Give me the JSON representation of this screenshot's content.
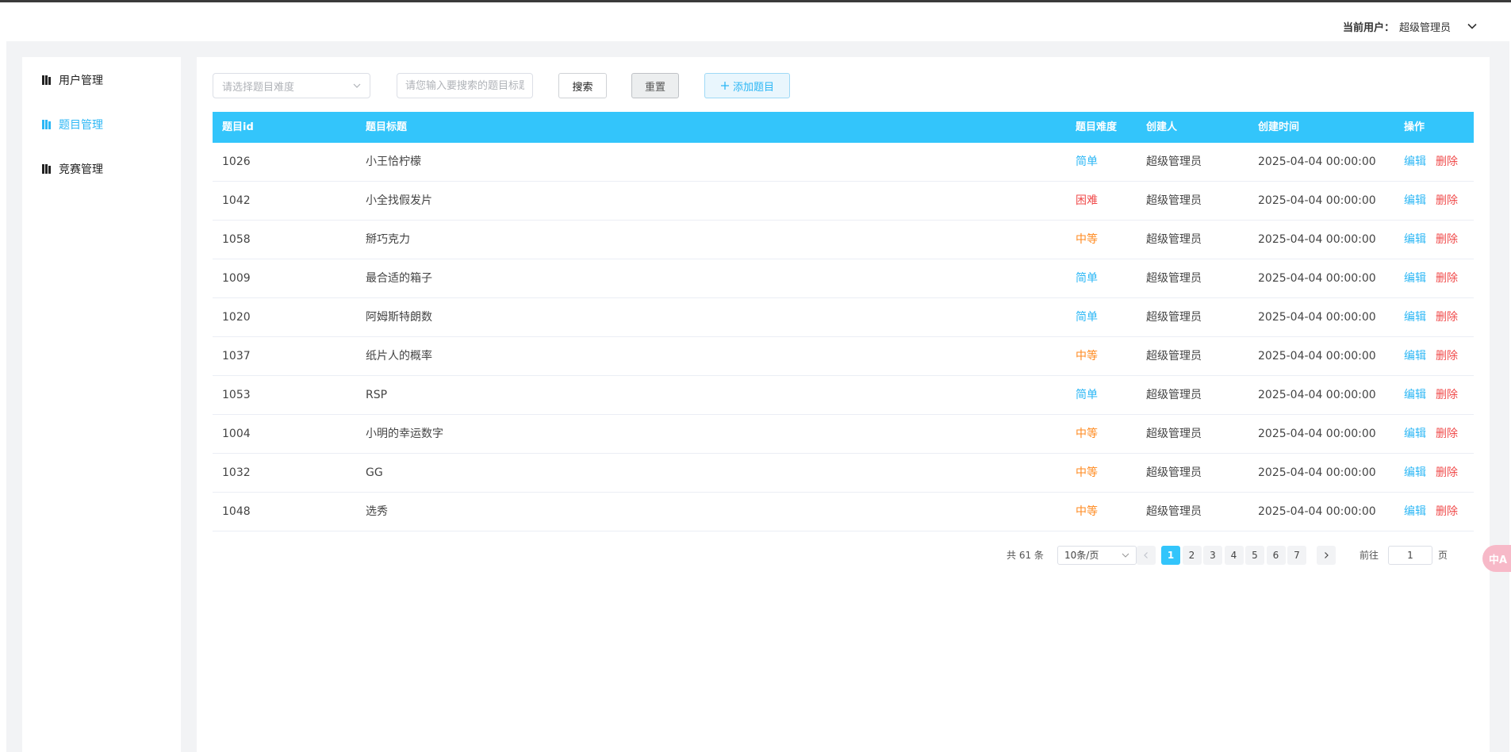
{
  "header": {
    "user_label": "当前用户：",
    "user_name": "超级管理员"
  },
  "sidebar": {
    "items": [
      {
        "label": "用户管理"
      },
      {
        "label": "题目管理"
      },
      {
        "label": "竞赛管理"
      }
    ]
  },
  "toolbar": {
    "difficulty_placeholder": "请选择题目难度",
    "search_placeholder": "请您输入要搜索的题目标题",
    "search_label": "搜索",
    "reset_label": "重置",
    "add_label": "添加题目"
  },
  "table": {
    "headers": {
      "id": "题目id",
      "title": "题目标题",
      "difficulty": "题目难度",
      "creator": "创建人",
      "created_at": "创建时间",
      "actions": "操作"
    },
    "edit_label": "编辑",
    "delete_label": "删除",
    "rows": [
      {
        "id": "1026",
        "title": "小王恰柠檬",
        "difficulty": "简单",
        "creator": "超级管理员",
        "created_at": "2025-04-04 00:00:00"
      },
      {
        "id": "1042",
        "title": "小全找假发片",
        "difficulty": "困难",
        "creator": "超级管理员",
        "created_at": "2025-04-04 00:00:00"
      },
      {
        "id": "1058",
        "title": "掰巧克力",
        "difficulty": "中等",
        "creator": "超级管理员",
        "created_at": "2025-04-04 00:00:00"
      },
      {
        "id": "1009",
        "title": "最合适的箱子",
        "difficulty": "简单",
        "creator": "超级管理员",
        "created_at": "2025-04-04 00:00:00"
      },
      {
        "id": "1020",
        "title": "阿姆斯特朗数",
        "difficulty": "简单",
        "creator": "超级管理员",
        "created_at": "2025-04-04 00:00:00"
      },
      {
        "id": "1037",
        "title": "纸片人的概率",
        "difficulty": "中等",
        "creator": "超级管理员",
        "created_at": "2025-04-04 00:00:00"
      },
      {
        "id": "1053",
        "title": "RSP",
        "difficulty": "简单",
        "creator": "超级管理员",
        "created_at": "2025-04-04 00:00:00"
      },
      {
        "id": "1004",
        "title": "小明的幸运数字",
        "difficulty": "中等",
        "creator": "超级管理员",
        "created_at": "2025-04-04 00:00:00"
      },
      {
        "id": "1032",
        "title": "GG",
        "difficulty": "中等",
        "creator": "超级管理员",
        "created_at": "2025-04-04 00:00:00"
      },
      {
        "id": "1048",
        "title": "选秀",
        "difficulty": "中等",
        "creator": "超级管理员",
        "created_at": "2025-04-04 00:00:00"
      }
    ]
  },
  "difficulty_colors": {
    "简单": "#2cb7f5",
    "中等": "#ff8a1f",
    "困难": "#f04b4b"
  },
  "pagination": {
    "total_text": "共 61 条",
    "page_size": "10条/页",
    "pages": [
      "1",
      "2",
      "3",
      "4",
      "5",
      "6",
      "7"
    ],
    "current_page": "1",
    "goto_label": "前往",
    "goto_value": "1",
    "page_unit": "页"
  },
  "float_badge": {
    "text": "中A"
  },
  "colors": {
    "accent": "#33c5fb",
    "danger": "#f04b4b"
  }
}
